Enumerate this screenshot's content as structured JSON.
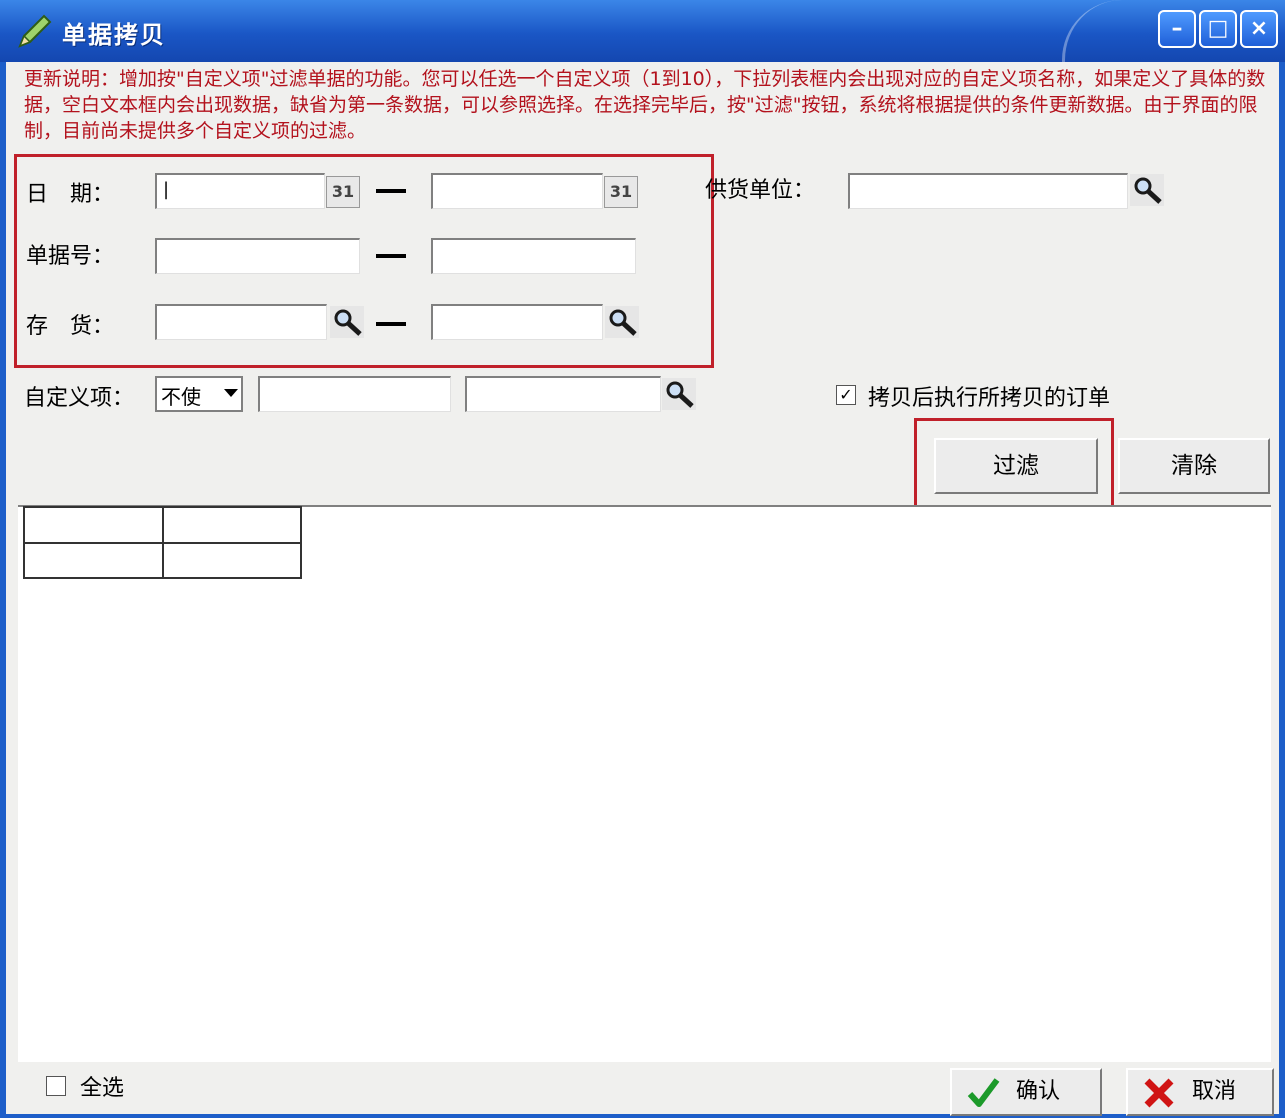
{
  "window": {
    "title": "单据拷贝"
  },
  "note": "更新说明：增加按\"自定义项\"过滤单据的功能。您可以任选一个自定义项（1到10），下拉列表框内会出现对应的自定义项名称，如果定义了具体的数据，空白文本框内会出现数据，缺省为第一条数据，可以参照选择。在选择完毕后，按\"过滤\"按钮，系统将根据提供的条件更新数据。由于界面的限制，目前尚未提供多个自定义项的过滤。",
  "filters": {
    "date_label": "日　期：",
    "docno_label": "单据号：",
    "inventory_label": "存　货：",
    "supplier_label": "供货单位：",
    "custom_label": "自定义项：",
    "custom_select_value": "不使",
    "date_from": "|",
    "date_to": "",
    "docno_from": "",
    "docno_to": "",
    "inventory_from": "",
    "inventory_to": "",
    "supplier": "",
    "custom_value1": "",
    "custom_value2": "",
    "calendar_glyph": "31"
  },
  "execute_after_copy": {
    "label": "拷贝后执行所拷贝的订单",
    "checked": true,
    "mark": "✓"
  },
  "buttons": {
    "filter": "过滤",
    "clear": "清除",
    "ok": "确认",
    "cancel": "取消"
  },
  "select_all": {
    "label": "全选",
    "checked": false
  },
  "colors": {
    "title_bar": "#1d5ec9",
    "highlight": "#c0202a",
    "note_text": "#b3121d"
  }
}
